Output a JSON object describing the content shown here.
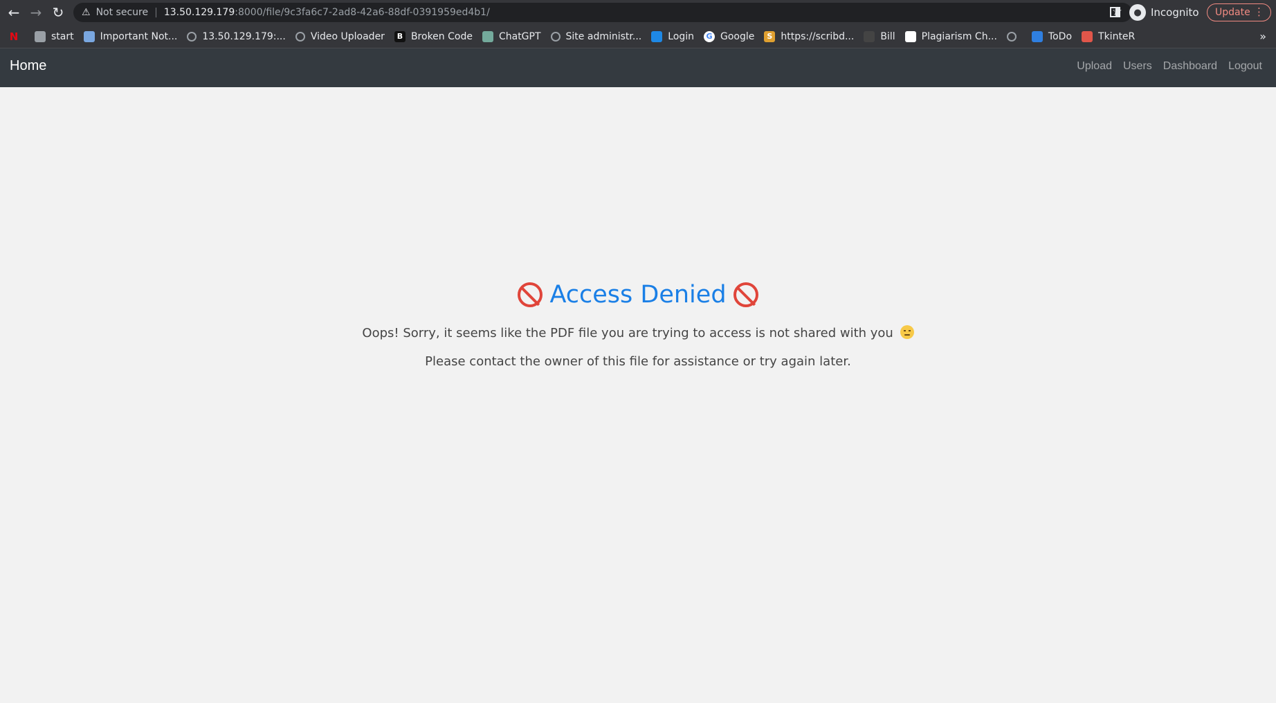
{
  "browser": {
    "security_label": "Not secure",
    "url_host": "13.50.129.179",
    "url_path": ":8000/file/9c3fa6c7-2ad8-42a6-88df-0391959ed4b1/",
    "profile_label": "Incognito",
    "update_label": "Update"
  },
  "bookmarks": [
    {
      "label": "",
      "icon": "netflix-icon",
      "color": "#e50914"
    },
    {
      "label": "start",
      "icon": "folder-icon",
      "color": "#9aa0a6"
    },
    {
      "label": "Important Not...",
      "icon": "notes-icon",
      "color": "#7aa7e0"
    },
    {
      "label": "13.50.129.179:...",
      "icon": "globe-icon",
      "color": "#9aa0a6"
    },
    {
      "label": "Video Uploader",
      "icon": "globe-icon",
      "color": "#9aa0a6"
    },
    {
      "label": "Broken Code",
      "icon": "b-icon",
      "color": "#111111"
    },
    {
      "label": "ChatGPT",
      "icon": "chatgpt-icon",
      "color": "#74aa9c"
    },
    {
      "label": "Site administr...",
      "icon": "globe-icon",
      "color": "#9aa0a6"
    },
    {
      "label": "Login",
      "icon": "login-icon",
      "color": "#1e88e5"
    },
    {
      "label": "Google",
      "icon": "google-icon",
      "color": "#ffffff"
    },
    {
      "label": "https://scribd...",
      "icon": "scribd-icon",
      "color": "#e0a030"
    },
    {
      "label": "Bill",
      "icon": "bill-icon",
      "color": "#444444"
    },
    {
      "label": "Plagiarism Ch...",
      "icon": "plagiarism-icon",
      "color": "#ffffff"
    },
    {
      "label": "",
      "icon": "globe-icon",
      "color": "#9aa0a6"
    },
    {
      "label": "ToDo",
      "icon": "todo-icon",
      "color": "#2f7fe0"
    },
    {
      "label": "TkinteR",
      "icon": "tkinter-icon",
      "color": "#e0564a"
    }
  ],
  "navbar": {
    "brand": "Home",
    "links": [
      "Upload",
      "Users",
      "Dashboard",
      "Logout"
    ]
  },
  "main": {
    "title": "Access Denied",
    "message1": "Oops! Sorry, it seems like the PDF file you are trying to access is not shared with you",
    "message2": "Please contact the owner of this file for assistance or try again later."
  },
  "colors": {
    "title": "#1a7fe6",
    "denied_icon": "#e0453a",
    "navbar_bg": "#343a40",
    "page_bg": "#f2f2f2"
  }
}
